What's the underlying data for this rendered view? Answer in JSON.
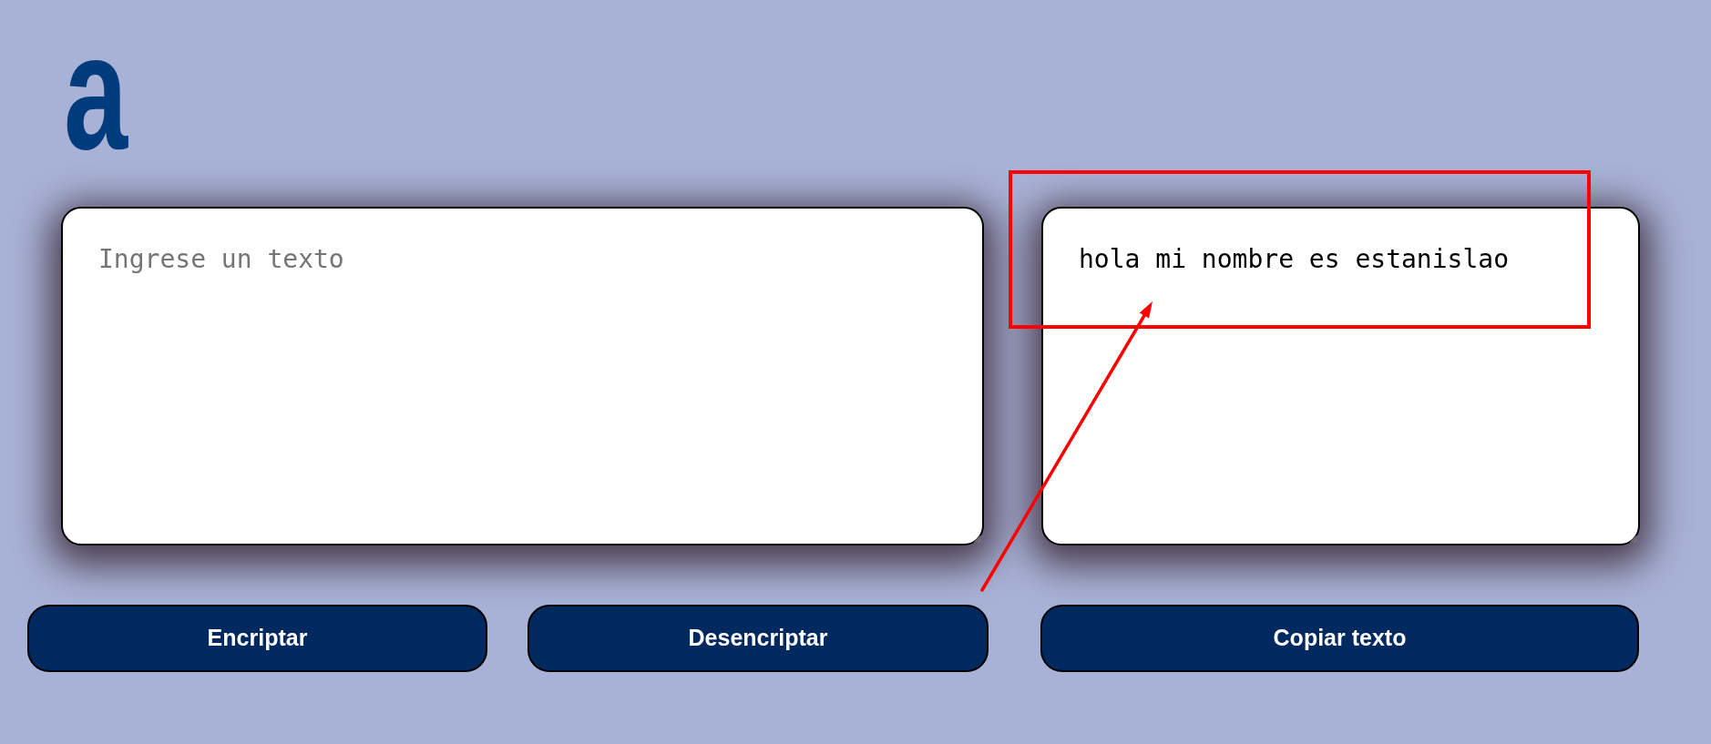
{
  "logo": {
    "text": "a"
  },
  "input_panel": {
    "placeholder": "Ingrese un texto",
    "buttons": [
      {
        "label": "Encriptar"
      },
      {
        "label": "Desencriptar"
      }
    ]
  },
  "output_panel": {
    "value": "hola mi nombre es estanislao",
    "button": {
      "label": "Copiar texto"
    }
  }
}
